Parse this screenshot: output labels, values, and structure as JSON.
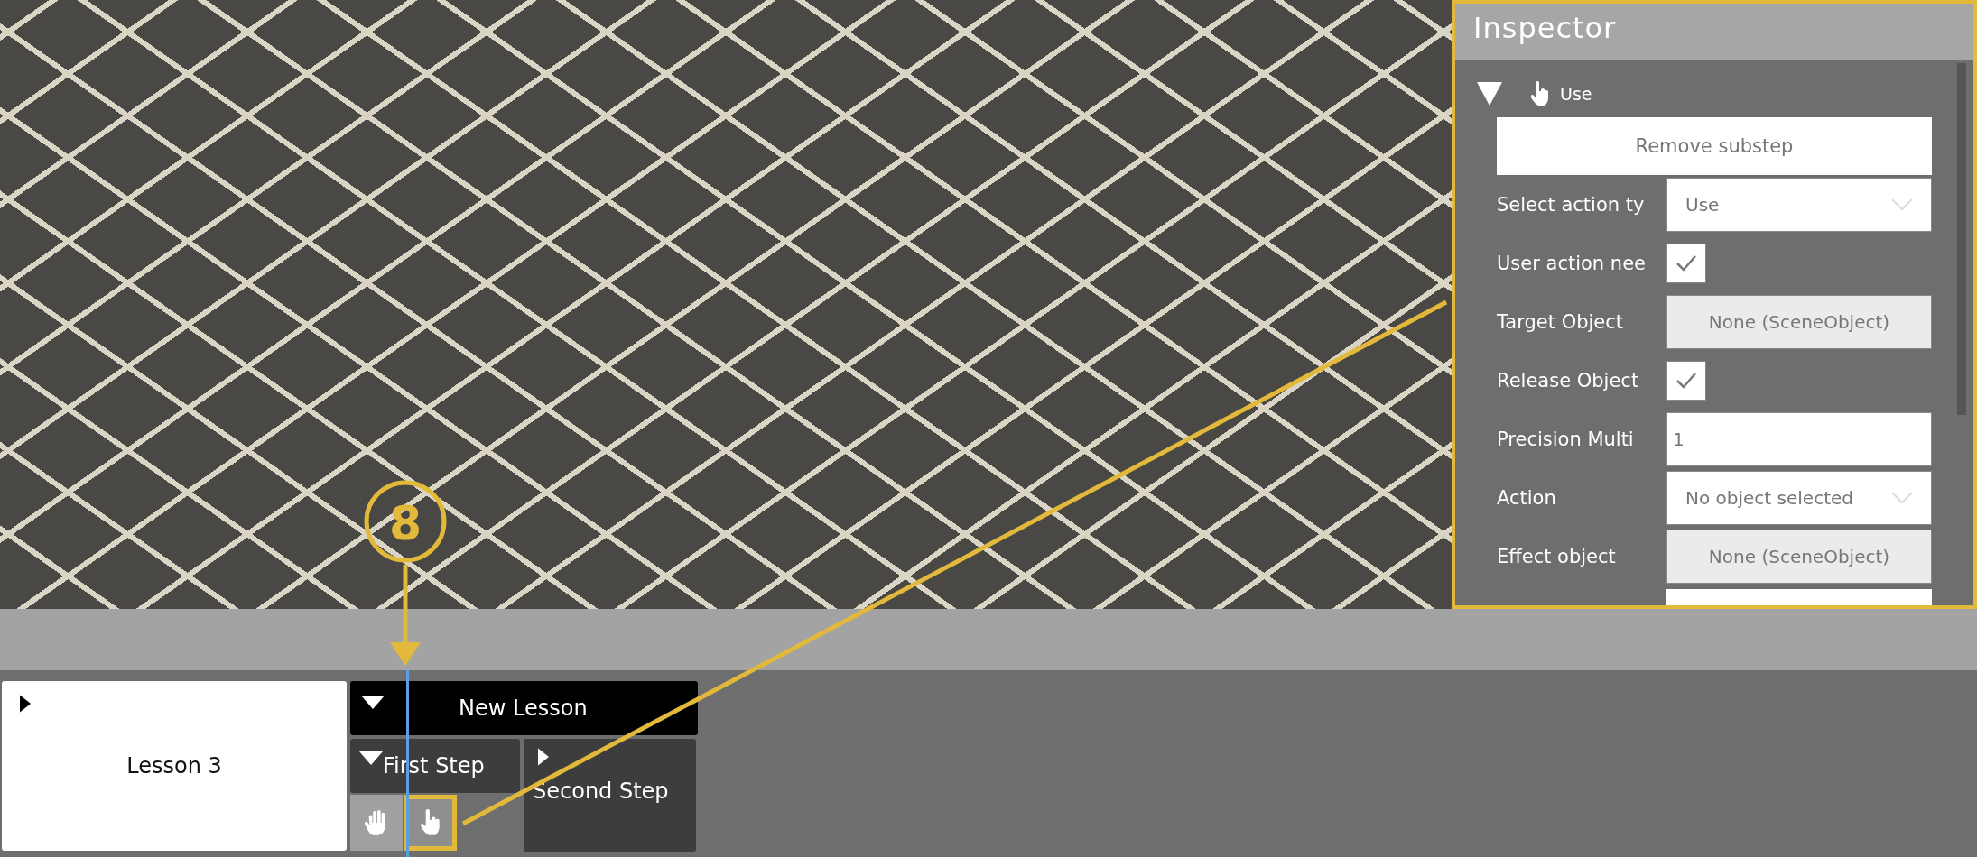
{
  "inspector": {
    "title": "Inspector",
    "substep": {
      "label": "Use",
      "expanded": true
    },
    "remove_button": "Remove substep",
    "fields": [
      {
        "kind": "dropdown",
        "label": "Select action ty",
        "value": "Use"
      },
      {
        "kind": "checkbox",
        "label": "User action nee",
        "checked": true
      },
      {
        "kind": "object",
        "label": "Target  Object",
        "value": "None (SceneObject)"
      },
      {
        "kind": "checkbox",
        "label": "Release  Object",
        "checked": true
      },
      {
        "kind": "text",
        "label": "Precision  Multi",
        "value": "1"
      },
      {
        "kind": "dropdown",
        "label": "Action",
        "value": "No object selected"
      },
      {
        "kind": "object",
        "label": "Effect object",
        "value": "None (SceneObject)"
      }
    ]
  },
  "timeline": {
    "lesson": {
      "label": "Lesson 3",
      "expanded": false
    },
    "course": {
      "label": "New Lesson",
      "expanded": true
    },
    "steps": [
      {
        "label": "First Step",
        "expanded": true,
        "substeps": [
          {
            "kind": "grab",
            "selected": false
          },
          {
            "kind": "use",
            "selected": true
          }
        ]
      },
      {
        "label": "Second Step",
        "expanded": false
      }
    ]
  },
  "callout": {
    "label": "8"
  }
}
